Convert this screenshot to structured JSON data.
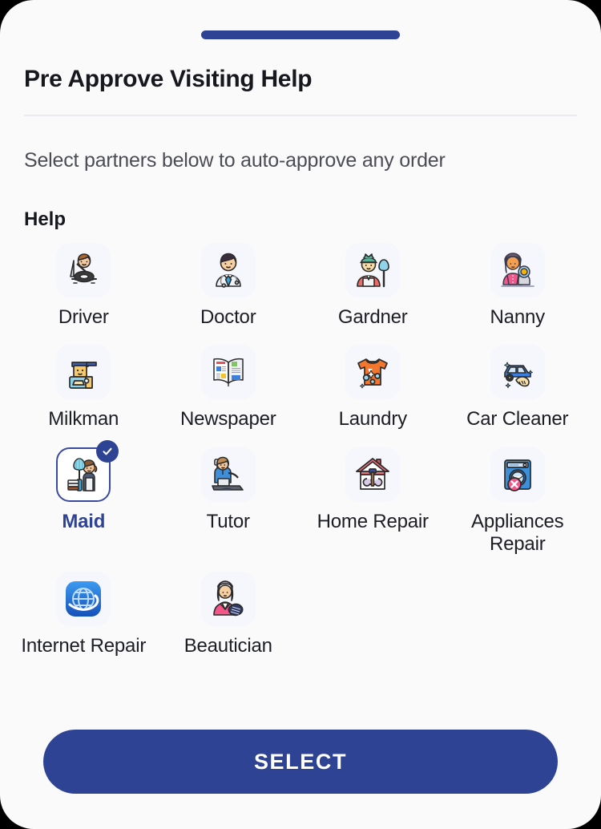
{
  "sheet": {
    "drag_handle": "drag-handle",
    "title": "Pre Approve Visiting Help",
    "subtitle": "Select partners below to auto-approve any order",
    "section_title": "Help"
  },
  "colors": {
    "accent": "#2f4394",
    "selected_border": "#3a4a9f",
    "tile_background": "#f6f6fd",
    "sheet_background": "#fafafa",
    "title_text": "#16181d",
    "subtitle_text": "#4b4d55",
    "divider": "#ececf0"
  },
  "grid": {
    "columns": 4,
    "items": [
      {
        "label": "Driver",
        "icon": "driver-icon",
        "selected": false
      },
      {
        "label": "Doctor",
        "icon": "doctor-icon",
        "selected": false
      },
      {
        "label": "Gardner",
        "icon": "gardner-icon",
        "selected": false
      },
      {
        "label": "Nanny",
        "icon": "nanny-icon",
        "selected": false
      },
      {
        "label": "Milkman",
        "icon": "milkman-icon",
        "selected": false
      },
      {
        "label": "Newspaper",
        "icon": "newspaper-icon",
        "selected": false
      },
      {
        "label": "Laundry",
        "icon": "laundry-icon",
        "selected": false
      },
      {
        "label": "Car Cleaner",
        "icon": "car-cleaner-icon",
        "selected": false
      },
      {
        "label": "Maid",
        "icon": "maid-icon",
        "selected": true
      },
      {
        "label": "Tutor",
        "icon": "tutor-icon",
        "selected": false
      },
      {
        "label": "Home Repair",
        "icon": "home-repair-icon",
        "selected": false
      },
      {
        "label": "Appliances Repair",
        "icon": "appliances-repair-icon",
        "selected": false
      },
      {
        "label": "Internet Repair",
        "icon": "internet-repair-icon",
        "selected": false
      },
      {
        "label": "Beautician",
        "icon": "beautician-icon",
        "selected": false
      }
    ]
  },
  "footer": {
    "select_label": "SELECT"
  }
}
